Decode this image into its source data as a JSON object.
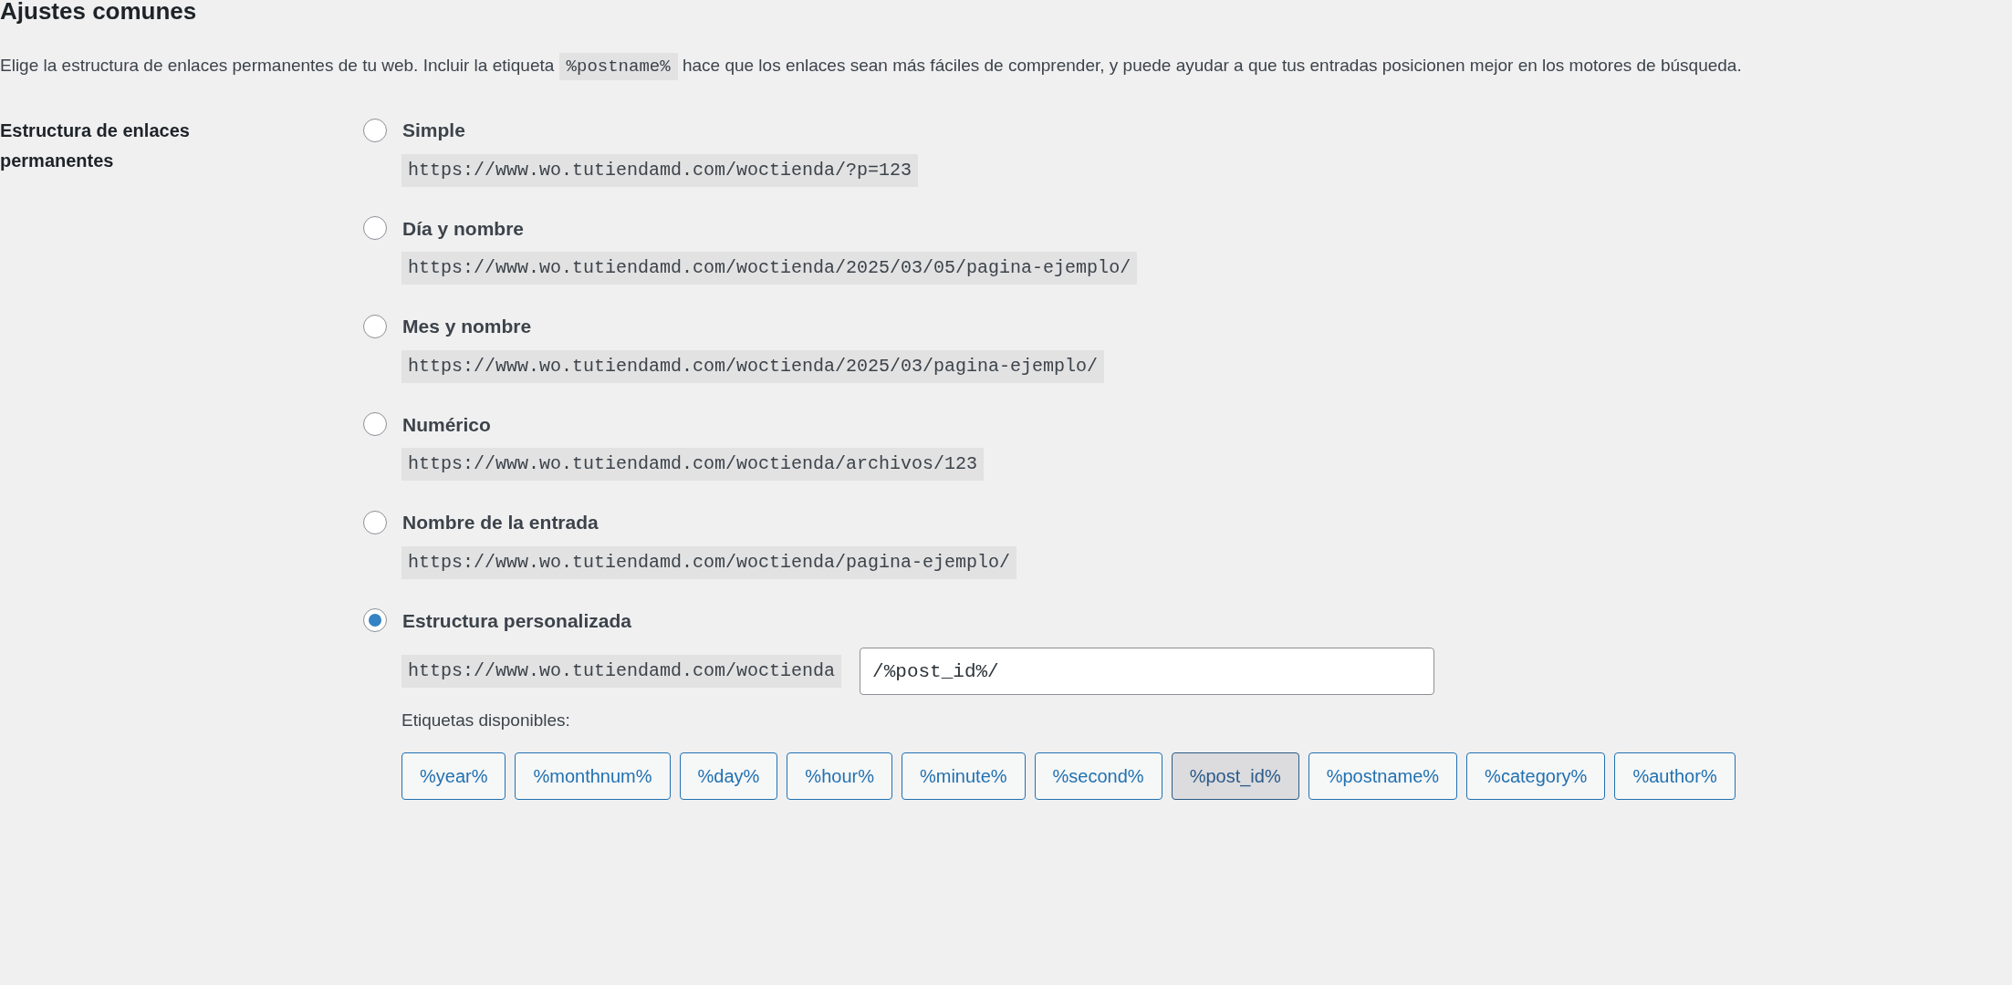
{
  "heading": "Ajustes comunes",
  "description": {
    "before": "Elige la estructura de enlaces permanentes de tu web. Incluir la etiqueta",
    "tag": "%postname%",
    "after": "hace que los enlaces sean más fáciles de comprender, y puede ayudar a que tus entradas posicionen mejor en los motores de búsqueda."
  },
  "field_label": "Estructura de enlaces permanentes",
  "options": [
    {
      "label": "Simple",
      "example": "https://www.wo.tutiendamd.com/woctienda/?p=123",
      "selected": false
    },
    {
      "label": "Día y nombre",
      "example": "https://www.wo.tutiendamd.com/woctienda/2025/03/05/pagina-ejemplo/",
      "selected": false
    },
    {
      "label": "Mes y nombre",
      "example": "https://www.wo.tutiendamd.com/woctienda/2025/03/pagina-ejemplo/",
      "selected": false
    },
    {
      "label": "Numérico",
      "example": "https://www.wo.tutiendamd.com/woctienda/archivos/123",
      "selected": false
    },
    {
      "label": "Nombre de la entrada",
      "example": "https://www.wo.tutiendamd.com/woctienda/pagina-ejemplo/",
      "selected": false
    },
    {
      "label": "Estructura personalizada",
      "example": "https://www.wo.tutiendamd.com/woctienda",
      "selected": true,
      "value": "/%post_id%/"
    }
  ],
  "tags_label": "Etiquetas disponibles:",
  "tags": [
    {
      "label": "%year%",
      "selected": false
    },
    {
      "label": "%monthnum%",
      "selected": false
    },
    {
      "label": "%day%",
      "selected": false
    },
    {
      "label": "%hour%",
      "selected": false
    },
    {
      "label": "%minute%",
      "selected": false
    },
    {
      "label": "%second%",
      "selected": false
    },
    {
      "label": "%post_id%",
      "selected": true
    },
    {
      "label": "%postname%",
      "selected": false
    },
    {
      "label": "%category%",
      "selected": false
    },
    {
      "label": "%author%",
      "selected": false
    }
  ]
}
